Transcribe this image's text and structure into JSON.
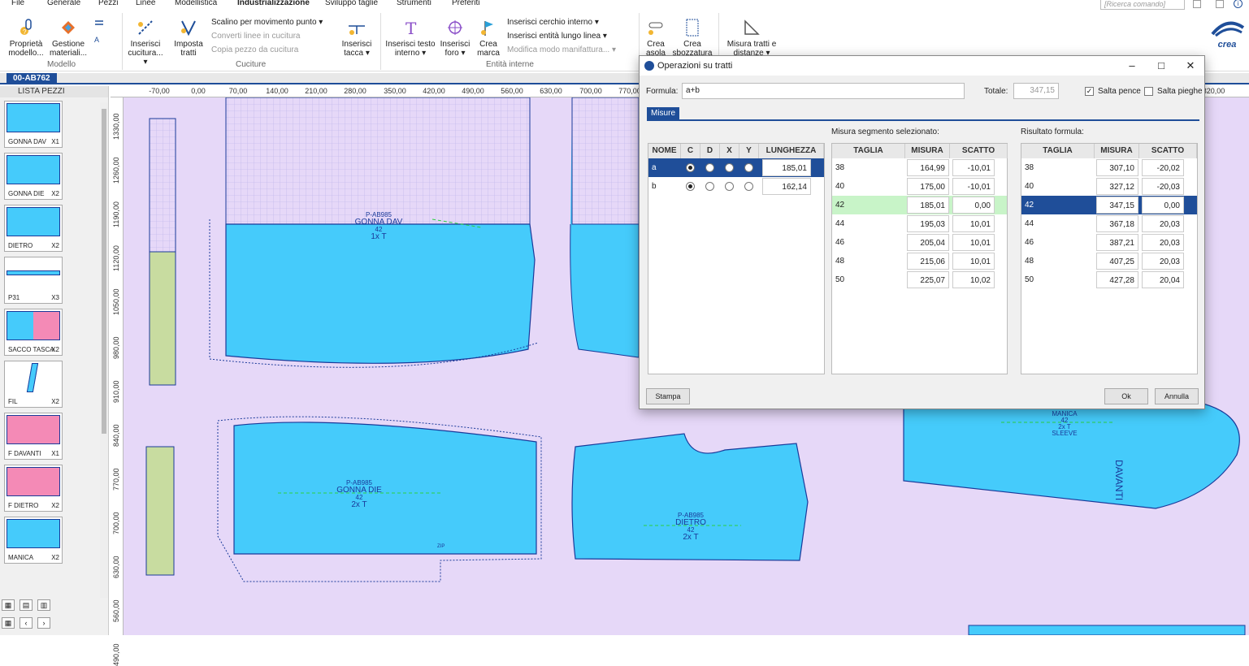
{
  "menu": [
    "File",
    "Generale",
    "Pezzi",
    "Linee",
    "Modellistica",
    "Industrializzazione",
    "Sviluppo taglie",
    "Strumenti",
    "Preferiti"
  ],
  "command_placeholder": "[Ricerca comando]",
  "brand": "crea",
  "ribbon": {
    "btn_prop": "Proprietà modello...",
    "btn_mat": "Gestione materiali...",
    "grp_modello": "Modello",
    "btn_cucitura": "Inserisci cucitura... ▾",
    "btn_imposta": "Imposta tratti",
    "s_scalino": "Scalino per movimento punto ▾",
    "s_converti": "Converti linee in cucitura",
    "s_copia": "Copia pezzo da cucitura",
    "btn_tacca": "Inserisci tacca ▾",
    "grp_cuciture": "Cuciture",
    "btn_testo": "Inserisci testo interno ▾",
    "btn_foro": "Inserisci foro ▾",
    "btn_marca": "Crea marca",
    "s_cerchio": "Inserisci cerchio interno ▾",
    "s_entita": "Inserisci entità lungo linea ▾",
    "s_modifica": "Modifica modo manifattura... ▾",
    "grp_entita": "Entità interne",
    "btn_asola": "Crea asola",
    "btn_sbozz": "Crea sbozzatura",
    "btn_misura": "Misura tratti e distanze ▾"
  },
  "doc_tab": "00-AB762",
  "lista_title": "LISTA PEZZI",
  "pieces": [
    {
      "name": "GONNA DAV",
      "qty": "X1"
    },
    {
      "name": "GONNA DIE",
      "qty": "X2"
    },
    {
      "name": "DIETRO",
      "qty": "X2"
    },
    {
      "name": "P31",
      "qty": "X3"
    },
    {
      "name": "SACCO TASCA",
      "qty": "X2"
    },
    {
      "name": "FIL",
      "qty": "X2"
    },
    {
      "name": "F DAVANTI",
      "qty": "X1"
    },
    {
      "name": "F DIETRO",
      "qty": "X2"
    },
    {
      "name": "MANICA",
      "qty": "X2"
    }
  ],
  "ruler_h": [
    "-70,00",
    "0,00",
    "70,00",
    "140,00",
    "210,00",
    "280,00",
    "350,00",
    "420,00",
    "490,00",
    "560,00",
    "630,00",
    "700,00",
    "770,00",
    "1820,00"
  ],
  "ruler_v": [
    "1330,00",
    "1260,00",
    "1190,00",
    "1120,00",
    "1050,00",
    "980,00",
    "910,00",
    "840,00",
    "770,00",
    "700,00",
    "630,00",
    "560,00",
    "490,00"
  ],
  "canvas_labels": {
    "gdav": [
      "P-AB985",
      "GONNA DAV",
      "42",
      "1x T"
    ],
    "gdie": [
      "P-AB985",
      "GONNA DIE",
      "42",
      "2x T"
    ],
    "dietro": [
      "P-AB985",
      "DIETRO",
      "42",
      "2x T"
    ],
    "manica": [
      "MANICA",
      "42",
      "2x T",
      "SLEEVE"
    ],
    "davanti": "DAVANTI",
    "zip": "ZIP"
  },
  "dialog": {
    "title": "Operazioni su tratti",
    "formula_label": "Formula:",
    "formula_value": "a+b",
    "totale_label": "Totale:",
    "totale_value": "347,15",
    "salta_pence": "Salta pence",
    "salta_pieghe": "Salta pieghe",
    "tab": "Misure",
    "seg_label": "Misura segmento selezionato:",
    "res_label": "Risultato formula:",
    "t1_headers": [
      "NOME",
      "C",
      "D",
      "X",
      "Y",
      "LUNGHEZZA"
    ],
    "t1_rows": [
      {
        "nome": "a",
        "len": "185,01",
        "sel": true
      },
      {
        "nome": "b",
        "len": "162,14",
        "sel": false
      }
    ],
    "t2_headers": [
      "TAGLIA",
      "MISURA",
      "SCATTO"
    ],
    "t2_rows": [
      [
        "38",
        "164,99",
        "-10,01"
      ],
      [
        "40",
        "175,00",
        "-10,01"
      ],
      [
        "42",
        "185,01",
        "0,00"
      ],
      [
        "44",
        "195,03",
        "10,01"
      ],
      [
        "46",
        "205,04",
        "10,01"
      ],
      [
        "48",
        "215,06",
        "10,01"
      ],
      [
        "50",
        "225,07",
        "10,02"
      ]
    ],
    "t3_headers": [
      "TAGLIA",
      "MISURA",
      "SCATTO"
    ],
    "t3_rows": [
      [
        "38",
        "307,10",
        "-20,02"
      ],
      [
        "40",
        "327,12",
        "-20,03"
      ],
      [
        "42",
        "347,15",
        "0,00"
      ],
      [
        "44",
        "367,18",
        "20,03"
      ],
      [
        "46",
        "387,21",
        "20,03"
      ],
      [
        "48",
        "407,25",
        "20,03"
      ],
      [
        "50",
        "427,28",
        "20,04"
      ]
    ],
    "btn_stampa": "Stampa",
    "btn_ok": "Ok",
    "btn_annulla": "Annulla"
  },
  "colors": {
    "piece_fill": "#45cbfb",
    "piece_stroke": "#1a3a9a",
    "canvas": "#e6d8f8",
    "accent": "#1f4e99",
    "green_piece": "#c8dca0"
  }
}
